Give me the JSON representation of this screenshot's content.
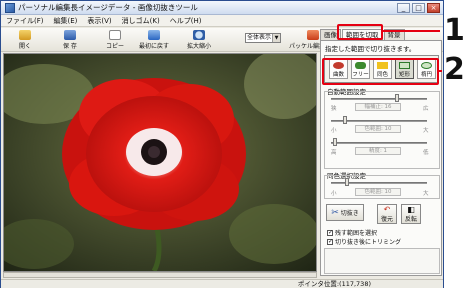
{
  "window": {
    "title": "パーソナル編集長イメージデータ - 画像切抜きツール",
    "controls": [
      "_",
      "□",
      "×"
    ]
  },
  "menu": [
    "ファイル(F)",
    "編集(E)",
    "表示(V)",
    "消しゴム(K)",
    "ヘルプ(H)"
  ],
  "toolbar": {
    "open": "開く",
    "save": "保 存",
    "copy": "コピー",
    "revert": "最初に戻す",
    "zoom": "拡大縮小",
    "zoom_value": "全体表示",
    "pe_edit": "パッケル編集長へ"
  },
  "panel": {
    "tabs": [
      "画像",
      "範囲を切取",
      "背景"
    ],
    "subtitle": "指定した範囲で切り抜きます。",
    "tools": [
      "曲数",
      "フリー",
      "同色",
      "矩形",
      "楕円"
    ],
    "auto_range_label": "自動範囲設定",
    "slider1": {
      "left": "狭",
      "value": "幅補正: 16",
      "right": "広"
    },
    "slider2": {
      "left": "小",
      "value": "色範囲: 10",
      "right": "大"
    },
    "slider3": {
      "left": "高",
      "value": "精度: 1",
      "right": "低"
    },
    "same_color_label": "同色選択設定",
    "slider4": {
      "left": "小",
      "value": "色範囲: 10",
      "right": "大"
    },
    "cut_button": "切抜き",
    "undo_button": "復元",
    "invert_button": "反転",
    "check1": "残す範囲を選択",
    "check2": "切り抜き後にトリミング"
  },
  "status": {
    "pointer": "ポインタ位置:(117,738)"
  },
  "callouts": [
    "1",
    "2"
  ],
  "colors": {
    "highlight": "#e50012",
    "flower": "#d41a14",
    "window_border": "#2a4d8f"
  }
}
